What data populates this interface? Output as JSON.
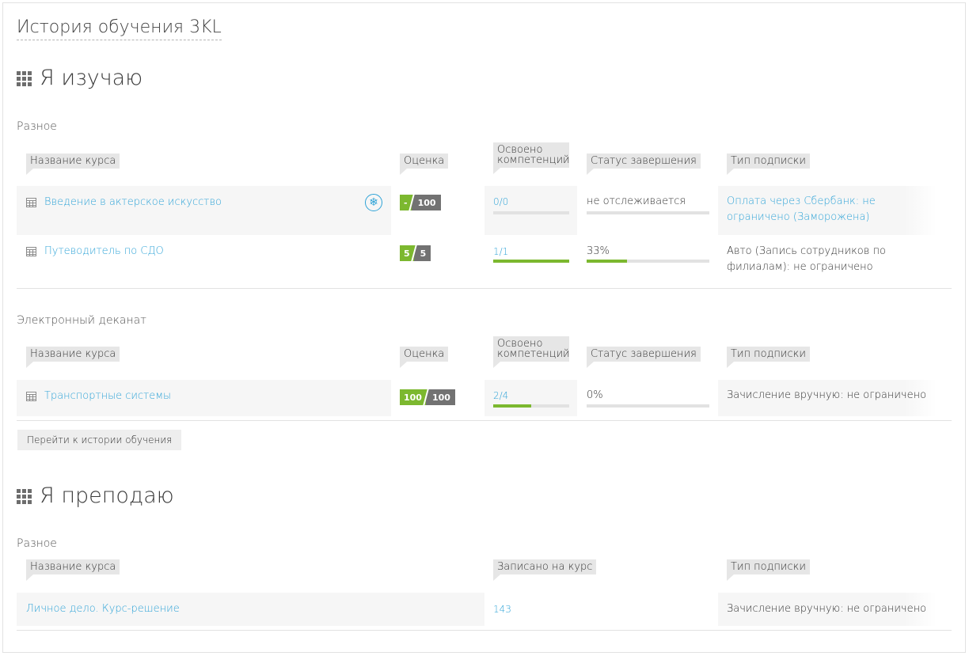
{
  "page": {
    "title": "История обучения 3KL"
  },
  "learning": {
    "title": "Я изучаю",
    "groups": [
      {
        "name": "Разное",
        "headers": {
          "course": "Название курса",
          "grade": "Оценка",
          "competencies": "Освоено компетенций",
          "status": "Статус завершения",
          "subscription": "Тип подписки"
        },
        "rows": [
          {
            "course": "Введение в актерское искусство",
            "grade": [
              "-",
              "100"
            ],
            "competencies": "0/0",
            "competencies_progress": 0,
            "status": "не отслеживается",
            "status_progress": 0,
            "subscription": "Оплата через Сбербанк: не ограничено (Заморожена)",
            "frozen": true
          },
          {
            "course": "Путеводитель по СДО",
            "grade": [
              "5",
              "5"
            ],
            "competencies": "1/1",
            "competencies_progress": 1,
            "status": "33%",
            "status_progress": 0.33,
            "subscription": "Авто (Запись сотрудников по филиалам): не ограничено",
            "frozen": false
          }
        ]
      },
      {
        "name": "Электронный деканат",
        "headers": {
          "course": "Название курса",
          "grade": "Оценка",
          "competencies": "Освоено компетенций",
          "status": "Статус завершения",
          "subscription": "Тип подписки"
        },
        "rows": [
          {
            "course": "Транспортные системы",
            "grade": [
              "100",
              "100"
            ],
            "competencies": "2/4",
            "competencies_progress": 0.5,
            "status": "0%",
            "status_progress": 0,
            "subscription": "Зачисление вручную: не ограничено"
          }
        ]
      }
    ],
    "history_button": "Перейти к истории обучения"
  },
  "teaching": {
    "title": "Я преподаю",
    "groups": [
      {
        "name": "Разное",
        "headers": {
          "course": "Название курса",
          "enrolled": "Записано на курс",
          "subscription": "Тип подписки"
        },
        "rows": [
          {
            "course": "Личное дело. Курс-решение",
            "enrolled": "143",
            "subscription": "Зачисление вручную: не ограничено"
          }
        ]
      }
    ]
  },
  "colors": {
    "link": "#2ea3d7",
    "accent_green": "#7cb82f",
    "grade_gray": "#727272",
    "header_bg": "#e6e6e6"
  },
  "icons": {
    "section": "grid-icon",
    "course": "course-table-icon",
    "frozen": "snowflake-icon"
  }
}
